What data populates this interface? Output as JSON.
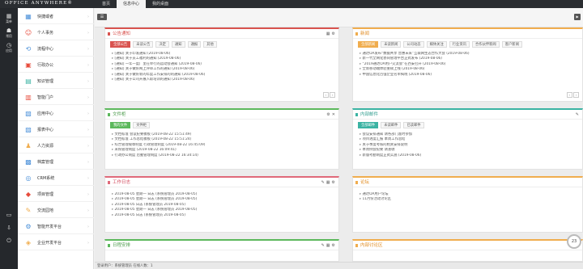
{
  "app": {
    "logo": "OFFICE ANYWHERE®"
  },
  "top_tabs": [
    {
      "label": "首页"
    },
    {
      "label": "信息中心"
    },
    {
      "label": "我的桌面"
    }
  ],
  "rail": [
    {
      "label": "菜单",
      "icon": "grid-icon"
    },
    {
      "label": "常用",
      "icon": "people-icon"
    },
    {
      "label": "应用",
      "icon": "clock-icon"
    },
    {
      "icon": "monitor-icon"
    },
    {
      "icon": "download-icon"
    },
    {
      "icon": "power-icon"
    }
  ],
  "sidebar": {
    "items": [
      {
        "label": "快捷或者",
        "icon": "grid-icon",
        "color": "#4a90d9"
      },
      {
        "label": "个人事务",
        "icon": "person-icon",
        "color": "#e74c3c"
      },
      {
        "label": "流程中心",
        "icon": "flow-icon",
        "color": "#4a90d9"
      },
      {
        "label": "行政办公",
        "icon": "briefcase-icon",
        "color": "#e74c3c"
      },
      {
        "label": "知识管理",
        "icon": "book-icon",
        "color": "#3bb3a3"
      },
      {
        "label": "智能门户",
        "icon": "portal-icon",
        "color": "#e74c3c"
      },
      {
        "label": "应用中心",
        "icon": "apps-icon",
        "color": "#4a90d9"
      },
      {
        "label": "报表中心",
        "icon": "chart-icon",
        "color": "#4a90d9"
      },
      {
        "label": "人力资源",
        "icon": "users-icon",
        "color": "#f0ad4e"
      },
      {
        "label": "档案管理",
        "icon": "archive-icon",
        "color": "#4a90d9"
      },
      {
        "label": "CRM系统",
        "icon": "crm-icon",
        "color": "#4a90d9"
      },
      {
        "label": "项目管理",
        "icon": "project-icon",
        "color": "#e74c3c"
      },
      {
        "label": "交流园地",
        "icon": "chat-icon",
        "color": "#f0ad4e"
      },
      {
        "label": "智能开发平台",
        "icon": "dev-icon",
        "color": "#4a90d9"
      },
      {
        "label": "企业开发平台",
        "icon": "platform-icon",
        "color": "#f0ad4e"
      }
    ]
  },
  "panels": {
    "notice": {
      "title": "公告通知",
      "pills": [
        "全部公告",
        "未读公告",
        "决定",
        "通知",
        "通报",
        "其他"
      ],
      "items": [
        "[通知] 关于印发通知 (2019-08-06)",
        "[通知] 关于员工福利的通知 (2019-08-06)",
        "[通知] 一年一度厂里在举行的运动会通知 (2019-08-06)",
        "[通知] 关于做好网上评审工作的通知 (2019-08-06)",
        "[通知] 关于做好新的年度工作安排的的通知 (2019-08-06)",
        "[通知] 关于公司开展入职培训的通知 (2019-08-06)"
      ]
    },
    "news": {
      "title": "新闻",
      "pills": [
        "全部新闻",
        "未读新闻",
        "公司动态",
        "媒体关注",
        "行业资讯",
        "合作伙伴新闻",
        "客户新闻"
      ],
      "items": [
        "通达OA发布“数据共享 普惠未来”互联网生态合作大会 (2019-08-06)",
        "新一代全网化协同管理平台正式发布 (2019-08-06)",
        "“2019通达OA用户交流会”在西安召开 (2019-08-06)",
        "全新移动端体验重磅上线 (2019-08-06)",
        "中国信息化百强企业名单揭晓 (2019-08-06)"
      ]
    },
    "files": {
      "title": "文件柜",
      "pills": [
        "我的文件",
        "文件柜"
      ],
      "items": [
        "文档标准 会议纪要模板 (2019-08-22 15:51:49)",
        "文档标准 工作总结模板 (2019-08-22 15:51:24)",
        "综合管理规章制度 行政管理制度 (2019-08-22 16:45:09)",
        "采购管理制度 (2019-08-22 16:09:41)",
        "行政办公制度 后勤管理制度 (2019-08-22 16:34:14)"
      ]
    },
    "mail": {
      "title": "内部邮件",
      "pills": [
        "全部邮件",
        "未读邮件",
        "已读邮件"
      ],
      "items": [
        "会议安排通知 请各部门准时参加",
        "项目进度汇报 本周工作总结",
        "关于季度考核的相关安排说明",
        "本周例会纪要 请查收",
        "新版考勤制度正式实施 (2019-08-06)"
      ]
    },
    "diary": {
      "title": "工作日志",
      "items": [
        "2019-08-05 星期一 日志 (系统管理员 2019-08-05)",
        "2019-08-05 星期一 日志 (系统管理员 2019-08-05)",
        "2019-08-05 日志 (系统管理员 2019-08-05)",
        "2019-08-05 星期一 日志 (系统管理员 2019-08-05)",
        "2019-08-05 日志 (系统管理员 2019-08-05)"
      ]
    },
    "forum": {
      "title": "论坛",
      "items": [
        "通达OA用户论坛",
        "11月份活动讨论区"
      ]
    },
    "calendar": {
      "title": "日程安排"
    },
    "community": {
      "title": "内部讨论区"
    }
  },
  "status": {
    "text": "登录用户：系统管理员 在线人数：1"
  },
  "float_badge": {
    "label": "23"
  }
}
